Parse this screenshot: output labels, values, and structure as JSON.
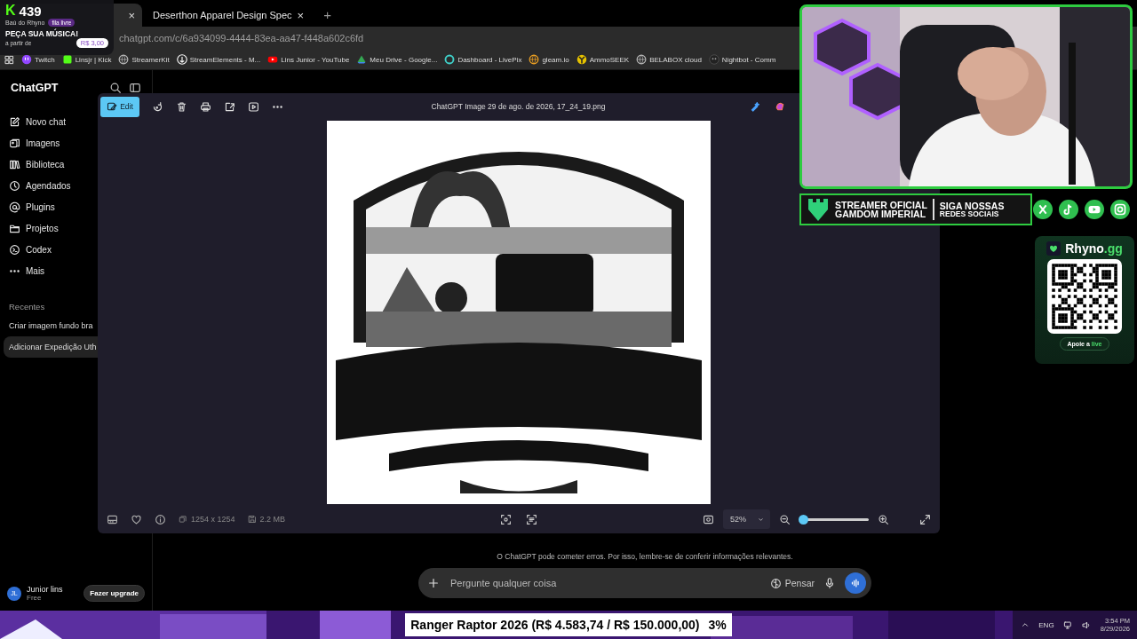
{
  "browser": {
    "tabs": [
      {
        "selected": true,
        "close": "×"
      },
      {
        "title": "Deserthon Apparel Design Spec",
        "selected": false,
        "close": "×"
      }
    ],
    "new_tab": "+",
    "url": "chatgpt.com/c/6a934099-4444-83ea-aa47-f448a602c6fd",
    "bookmarks": [
      {
        "kind": "twitch",
        "label": "Twitch"
      },
      {
        "kind": "kick",
        "label": "Linsjr | Kick"
      },
      {
        "kind": "globe",
        "label": "StreamerKit"
      },
      {
        "kind": "anchor",
        "label": "StreamElements - M..."
      },
      {
        "kind": "youtube",
        "label": "Lins Junior - YouTube"
      },
      {
        "kind": "drive",
        "label": "Meu Drive - Google..."
      },
      {
        "kind": "livepix",
        "label": "Dashboard - LivePix"
      },
      {
        "kind": "gleam",
        "label": "gleam.io"
      },
      {
        "kind": "ammo",
        "label": "AmmoSEEK"
      },
      {
        "kind": "globe",
        "label": "BELABOX cloud"
      },
      {
        "kind": "bot",
        "label": "Nightbot - Comm"
      }
    ]
  },
  "sidebar": {
    "title": "ChatGPT",
    "items": [
      {
        "kind": "new",
        "label": "Novo chat"
      },
      {
        "kind": "images",
        "label": "Imagens"
      },
      {
        "kind": "library",
        "label": "Biblioteca"
      },
      {
        "kind": "clock",
        "label": "Agendados"
      },
      {
        "kind": "at",
        "label": "Plugins"
      },
      {
        "kind": "folder",
        "label": "Projetos"
      },
      {
        "kind": "codex",
        "label": "Codex"
      },
      {
        "kind": "more",
        "label": "Mais"
      }
    ],
    "recent_heading": "Recentes",
    "recents": [
      {
        "label": "Criar imagem fundo bra",
        "selected": false
      },
      {
        "label": "Adicionar Expedição Uth",
        "selected": true
      }
    ],
    "user": {
      "initials": "JL",
      "name": "Junior lins",
      "plan": "Free"
    },
    "upgrade": "Fazer upgrade"
  },
  "image_viewer": {
    "tools": [
      {
        "kind": "edit",
        "label": "Edit"
      },
      {
        "kind": "rotate"
      },
      {
        "kind": "delete"
      },
      {
        "kind": "print"
      },
      {
        "kind": "share"
      },
      {
        "kind": "slideshow"
      },
      {
        "kind": "more"
      }
    ],
    "title": "ChatGPT Image 29 de ago. de 2026, 17_24_19.png",
    "dimensions": "1254 x 1254",
    "file_size": "2.2 MB",
    "zoom": "52%",
    "zoom_slider": {
      "level": 0.05
    }
  },
  "chat": {
    "disclaimer": "O ChatGPT pode cometer erros. Por isso, lembre-se de conferir informações relevantes.",
    "composer": {
      "placeholder": "Pergunte qualquer coisa",
      "think": "Pensar"
    }
  },
  "stream_overlay": {
    "song_request": {
      "logo": "K",
      "count": "439",
      "channel": "Baú do Rhyno",
      "badge": "fila livre",
      "title": "PEÇA SUA MÚSICA!",
      "price_label": "a partir de",
      "price": "R$ 3,00"
    },
    "partner_banner": {
      "line_1": "STREAMER OFICIAL",
      "line_2": "GAMDOM IMPERIAL",
      "follow_1": "SIGA NOSSAS",
      "follow_2": "REDES SOCIAIS"
    },
    "socials": [
      {
        "kind": "x"
      },
      {
        "kind": "tiktok"
      },
      {
        "kind": "youtube"
      },
      {
        "kind": "instagram"
      }
    ],
    "donation_card": {
      "name": "Rhyno",
      "suffix": ".gg",
      "button": "Apoie a",
      "button_highlight": "live"
    },
    "goal": {
      "text": "Ranger Raptor 2026 (R$ 4.583,74 / R$ 150.000,00)",
      "percent": "3%"
    }
  },
  "taskbar": {
    "language": "ENG",
    "time": "3:54 PM",
    "date": "8/29/2026"
  }
}
